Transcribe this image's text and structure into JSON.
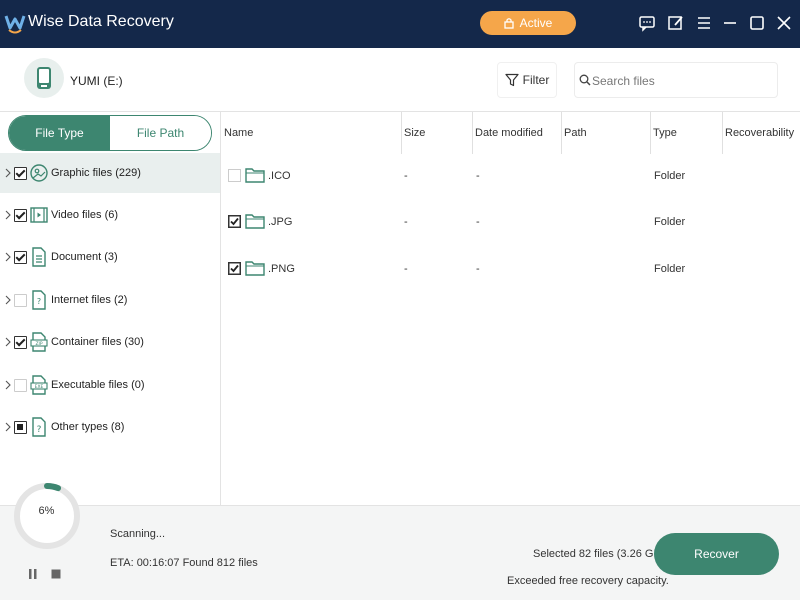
{
  "app": {
    "title": "Wise Data Recovery",
    "active_label": "Active",
    "accent": "#3d8670",
    "titlebar_color": "#14284a",
    "active_color": "#f5a64a"
  },
  "titlebar_icons": [
    "feedback-icon",
    "edit-icon",
    "menu-icon",
    "minimize-icon",
    "maximize-icon",
    "close-icon"
  ],
  "header": {
    "drive_label": "YUMI (E:)",
    "filter_label": "Filter",
    "search_placeholder": "Search files",
    "search_value": ""
  },
  "sidebar": {
    "tabs": [
      {
        "label": "File Type",
        "selected": true
      },
      {
        "label": "File Path",
        "selected": false
      }
    ],
    "items": [
      {
        "label": "Graphic files (229)",
        "check": "checked",
        "icon": "image-icon",
        "selected": true
      },
      {
        "label": "Video files (6)",
        "check": "checked",
        "icon": "video-icon",
        "selected": false
      },
      {
        "label": "Document (3)",
        "check": "checked",
        "icon": "document-icon",
        "selected": false
      },
      {
        "label": "Internet files (2)",
        "check": "unchecked",
        "icon": "internet-file-icon",
        "selected": false
      },
      {
        "label": "Container files (30)",
        "check": "checked",
        "icon": "zip-icon",
        "selected": false
      },
      {
        "label": "Executable files (0)",
        "check": "unchecked",
        "icon": "exe-icon",
        "selected": false
      },
      {
        "label": "Other types (8)",
        "check": "partial",
        "icon": "unknown-file-icon",
        "selected": false
      }
    ]
  },
  "table": {
    "columns": [
      "Name",
      "Size",
      "Date modified",
      "Path",
      "Type",
      "Recoverability"
    ],
    "rows": [
      {
        "checked": false,
        "name": ".ICO",
        "size": "-",
        "date": "-",
        "path": "",
        "type": "Folder",
        "recoverability": ""
      },
      {
        "checked": true,
        "name": ".JPG",
        "size": "-",
        "date": "-",
        "path": "",
        "type": "Folder",
        "recoverability": ""
      },
      {
        "checked": true,
        "name": ".PNG",
        "size": "-",
        "date": "-",
        "path": "",
        "type": "Folder",
        "recoverability": ""
      }
    ]
  },
  "status": {
    "progress_percent": 6,
    "progress_label": "6%",
    "scanning": "Scanning...",
    "eta": "ETA: 00:16:07 Found 812 files",
    "selected": "Selected 82 files (3.26 GB)",
    "exceeded": "Exceeded free recovery capacity.",
    "recover_label": "Recover"
  }
}
